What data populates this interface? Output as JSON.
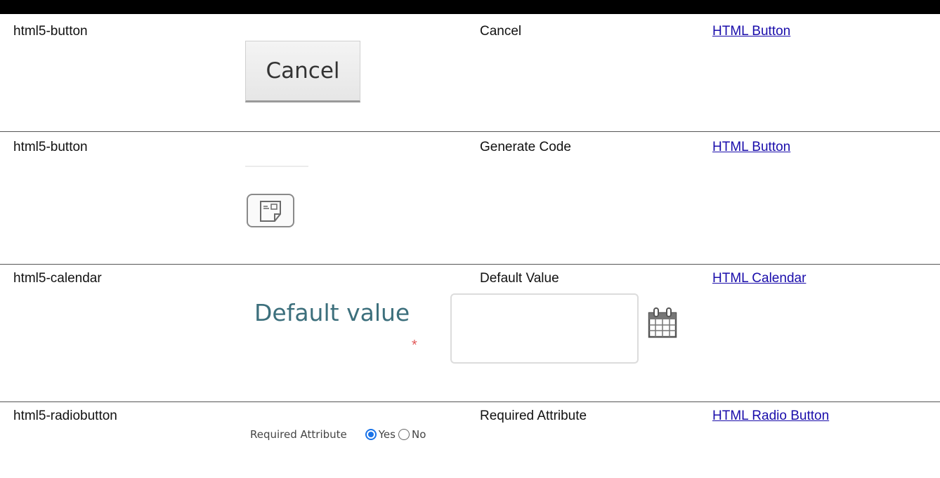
{
  "rows": [
    {
      "type": "html5-button",
      "label": "Cancel",
      "link": "HTML Button",
      "preview": {
        "button_label": "Cancel"
      }
    },
    {
      "type": "html5-button",
      "label": "Generate Code",
      "link": "HTML Button",
      "preview": {
        "icon": "generate-code-icon"
      }
    },
    {
      "type": "html5-calendar",
      "label": "Default Value",
      "link": "HTML Calendar",
      "preview": {
        "field_label": "Default value",
        "required_mark": "*",
        "value": "",
        "icon": "calendar-icon"
      }
    },
    {
      "type": "html5-radiobutton",
      "label": "Required Attribute",
      "link": "HTML Radio Button",
      "preview": {
        "field_label": "Required Attribute",
        "options": [
          "Yes",
          "No"
        ],
        "selected": "Yes",
        "accent": "#1a73e8"
      }
    }
  ]
}
